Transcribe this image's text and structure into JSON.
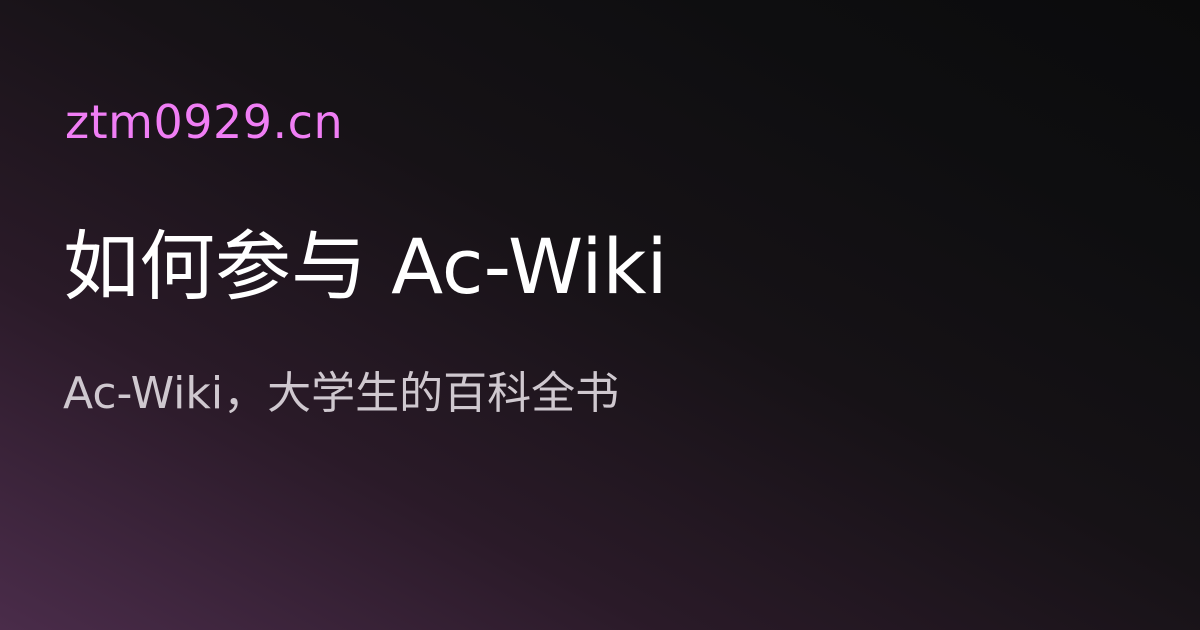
{
  "card": {
    "site": "ztm0929.cn",
    "title": "如何参与 Ac-Wiki",
    "subtitle": "Ac-Wiki，大学生的百科全书"
  },
  "colors": {
    "site_accent": "#f07ef5",
    "title": "#ffffff",
    "subtitle": "#cfc8cf",
    "background_dark": "#0b0b0c",
    "background_glow": "#4a2c4a"
  }
}
